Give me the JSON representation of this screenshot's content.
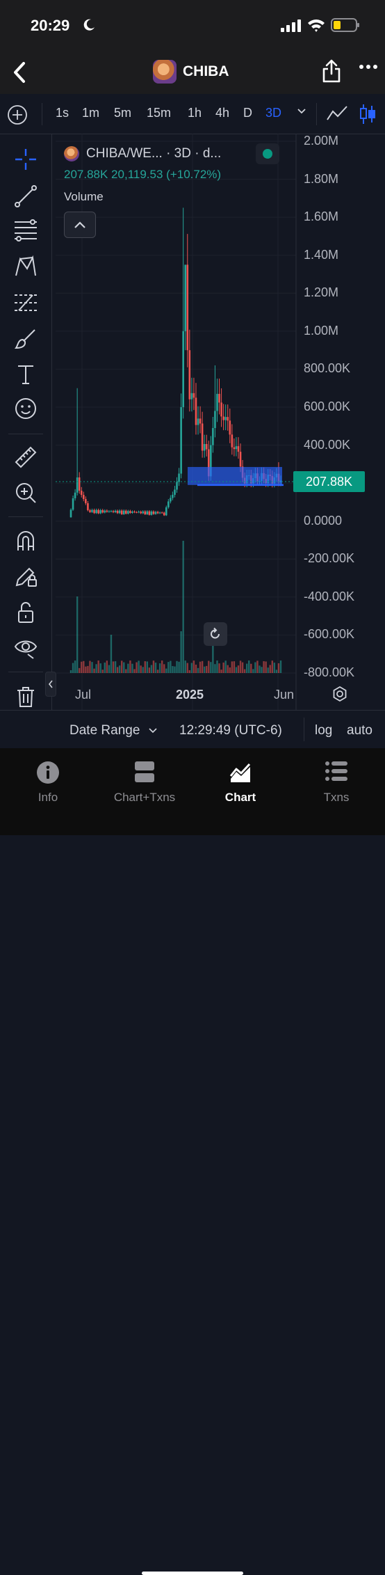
{
  "status": {
    "time": "20:29"
  },
  "nav": {
    "title": "CHIBA"
  },
  "toolbar": {
    "timeframes": [
      "1s",
      "1m",
      "5m",
      "15m",
      "1h",
      "4h",
      "D",
      "3D"
    ],
    "active_timeframe": "3D"
  },
  "legend": {
    "title": "CHIBA/WE... · 3D · d...",
    "values": "207.88K  20,119.53 (+10.72%)",
    "volume_label": "Volume"
  },
  "price_tag": "207.88K",
  "chart_data": {
    "type": "candlestick",
    "series_name": "CHIBA/WE...",
    "interval": "3D",
    "y_axis": {
      "ticks": [
        "2.00M",
        "1.80M",
        "1.60M",
        "1.40M",
        "1.20M",
        "1.00M",
        "800.00K",
        "600.00K",
        "400.00K",
        "200.00K",
        "0.0000",
        "-200.00K",
        "-400.00K",
        "-600.00K",
        "-800.00K"
      ],
      "range": [
        -800000,
        2000000
      ]
    },
    "x_axis": {
      "ticks": [
        "Jul",
        "2025",
        "Jun"
      ]
    },
    "last_price": 207880,
    "change": "20,119.53",
    "change_pct": "+10.72%",
    "colors": {
      "up": "#26a69a",
      "down": "#ef5350",
      "highlight": "#2962ff"
    },
    "highlight_range_y": [
      190000,
      285000
    ]
  },
  "bottom": {
    "date_range": "Date Range",
    "clock": "12:29:49 (UTC-6)",
    "log": "log",
    "auto": "auto"
  },
  "tabs": [
    {
      "label": "Info",
      "icon": "info-icon"
    },
    {
      "label": "Chart+Txns",
      "icon": "chart-txns-icon"
    },
    {
      "label": "Chart",
      "icon": "chart-icon",
      "active": true
    },
    {
      "label": "Txns",
      "icon": "txns-list-icon"
    }
  ]
}
